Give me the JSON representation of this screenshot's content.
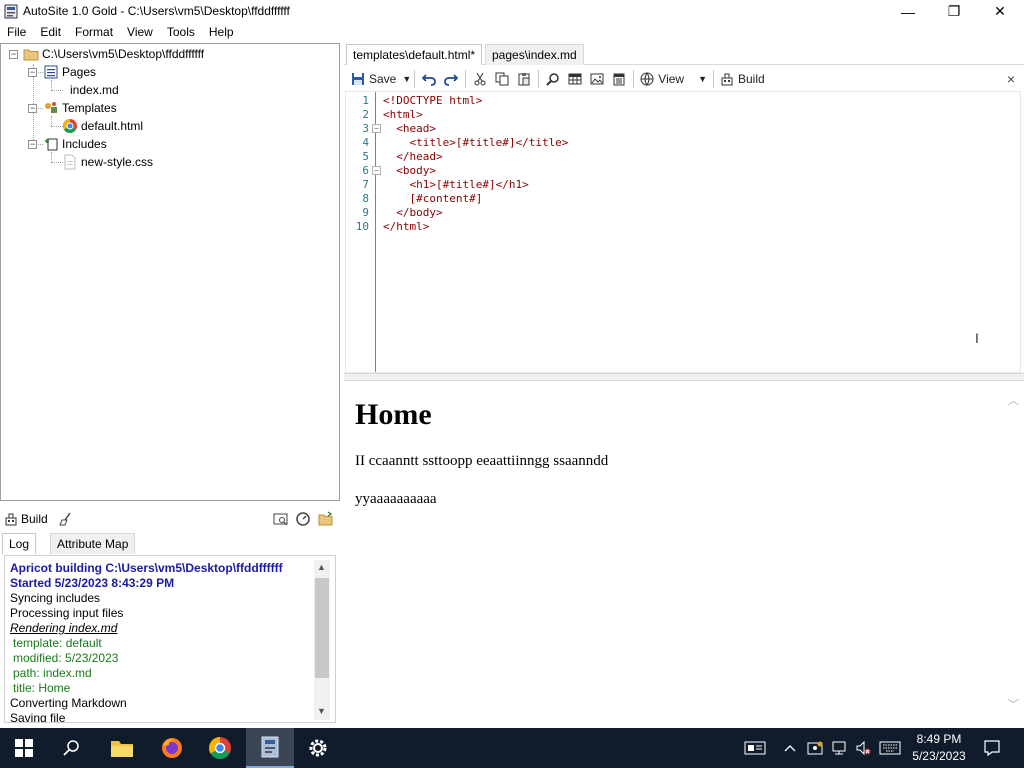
{
  "window": {
    "title": "AutoSite 1.0 Gold - C:\\Users\\vm5\\Desktop\\ffddffffff",
    "minimize": "—",
    "restore": "❐",
    "close": "✕"
  },
  "menu": [
    "File",
    "Edit",
    "Format",
    "View",
    "Tools",
    "Help"
  ],
  "tree": {
    "root": "C:\\Users\\vm5\\Desktop\\ffddffffff",
    "pages": "Pages",
    "pages_child": "index.md",
    "templates": "Templates",
    "templates_child": "default.html",
    "includes": "Includes",
    "includes_child": "new-style.css"
  },
  "build_panel": {
    "build_label": "Build",
    "tabs": [
      "Log",
      "Attribute Map"
    ],
    "log": [
      {
        "text": "Apricot building C:\\Users\\vm5\\Desktop\\ffddffffff",
        "style": "heading"
      },
      {
        "text": "Started 5/23/2023 8:43:29 PM",
        "style": "heading"
      },
      {
        "text": "Syncing includes",
        "style": "normal"
      },
      {
        "text": "Processing input files",
        "style": "normal"
      },
      {
        "text": "Rendering index.md",
        "style": "italic"
      },
      {
        "text": "template: default",
        "style": "green"
      },
      {
        "text": "modified: 5/23/2023",
        "style": "green"
      },
      {
        "text": "path: index.md",
        "style": "green"
      },
      {
        "text": "title: Home",
        "style": "green"
      },
      {
        "text": "Converting Markdown",
        "style": "normal"
      },
      {
        "text": "Saving file",
        "style": "normal"
      }
    ]
  },
  "editor_tabs": [
    "templates\\default.html*",
    "pages\\index.md"
  ],
  "toolbar": {
    "save": "Save",
    "view": "View",
    "build": "Build",
    "close": "×"
  },
  "code": {
    "line_numbers": [
      "1",
      "2",
      "3",
      "4",
      "5",
      "6",
      "7",
      "8",
      "9",
      "10"
    ],
    "lines": [
      "<!DOCTYPE html>",
      "<html>",
      "  <head>",
      "    <title>[#title#]</title>",
      "  </head>",
      "  <body>",
      "    <h1>[#title#]</h1>",
      "    [#content#]",
      "  </body>",
      "</html>"
    ]
  },
  "preview": {
    "heading": "Home",
    "para1": "II ccaanntt ssttoopp eeaattiinngg ssaanndd",
    "para2": "yyaaaaaaaaaa"
  },
  "taskbar": {
    "time": "8:49 PM",
    "date": "5/23/2023"
  }
}
